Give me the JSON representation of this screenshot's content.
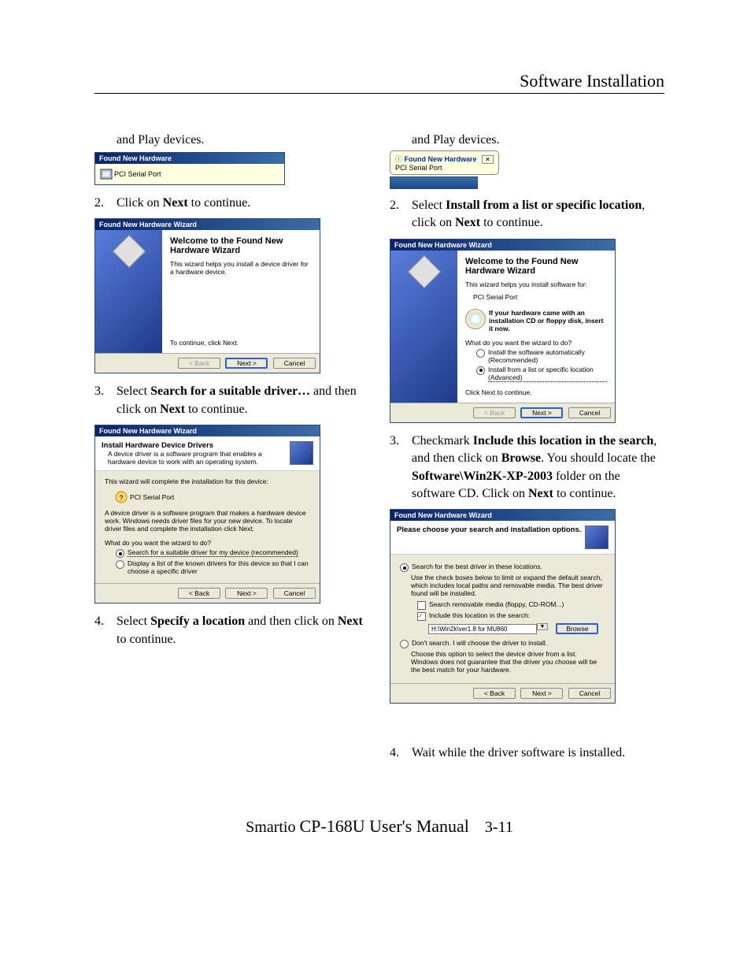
{
  "header": "Software Installation",
  "footer": {
    "prefix": "Smartio ",
    "manual": "CP-168U User's Manual",
    "page": "3-11"
  },
  "left": {
    "pnp": "and Play devices.",
    "s1": {
      "titlebar": "Found New Hardware",
      "device": "PCI Serial Port"
    },
    "step2": {
      "n": "2.",
      "a": "Click on ",
      "b": "Next",
      "c": " to continue."
    },
    "s2": {
      "titlebar": "Found New Hardware Wizard",
      "wtitle": "Welcome to the Found New Hardware Wizard",
      "sub": "This wizard helps you install a device driver for a hardware device.",
      "cont": "To continue, click Next.",
      "back": "< Back",
      "next": "Next >",
      "cancel": "Cancel"
    },
    "step3": {
      "n": "3.",
      "a": "Select ",
      "b": "Search for a suitable driver…",
      "c": " and then click on ",
      "d": "Next",
      "e": " to continue."
    },
    "s3": {
      "titlebar": "Found New Hardware Wizard",
      "htitle": "Install Hardware Device Drivers",
      "hsub": "A device driver is a software program that enables a hardware device to work with an operating system.",
      "line1": "This wizard will complete the installation for this device:",
      "device": "PCI Serial Port",
      "line2": "A device driver is a software program that makes a hardware device work. Windows needs driver files for your new device. To locate driver files and complete the installation click Next.",
      "q": "What do you want the wizard to do?",
      "r1": "Search for a suitable driver for my device (recommended)",
      "r2": "Display a list of the known drivers for this device so that I can choose a specific driver",
      "back": "< Back",
      "next": "Next >",
      "cancel": "Cancel"
    },
    "step4": {
      "n": "4.",
      "a": "Select ",
      "b": "Specify a location",
      "c": " and then click on ",
      "d": "Next",
      "e": " to continue."
    }
  },
  "right": {
    "pnp": "and Play devices.",
    "s1": {
      "btitle": "Found New Hardware",
      "device": "PCI Serial Port"
    },
    "step2": {
      "n": "2.",
      "a": "Select ",
      "b": "Install from a list or specific location",
      "c": ", click on ",
      "d": "Next",
      "e": " to continue."
    },
    "s2": {
      "titlebar": "Found New Hardware Wizard",
      "wtitle": "Welcome to the Found New Hardware Wizard",
      "sub": "This wizard helps you install software for:",
      "device": "PCI Serial Port",
      "cdnote": "If your hardware came with an installation CD or floppy disk, insert it now.",
      "q": "What do you want the wizard to do?",
      "r1": "Install the software automatically (Recommended)",
      "r2": "Install from a list or specific location (Advanced)",
      "cont": "Click Next to continue.",
      "back": "< Back",
      "next": "Next >",
      "cancel": "Cancel"
    },
    "step3": {
      "n": "3.",
      "a": "Checkmark ",
      "b": "Include this location in the search",
      "c": ", and then click on ",
      "d": "Browse",
      "e": ". You should locate the ",
      "f": "Software\\Win2K-XP-2003",
      "g": " folder on the software CD. Click on ",
      "h": "Next",
      "i": " to continue."
    },
    "s3": {
      "titlebar": "Found New Hardware Wizard",
      "htitle": "Please choose your search and installation options.",
      "r1": "Search for the best driver in these locations.",
      "r1sub": "Use the check boxes below to limit or expand the default search, which includes local paths and removable media. The best driver found will be installed.",
      "c1": "Search removable media (floppy, CD-ROM...)",
      "c2": "Include this location in the search:",
      "path": "H:\\Win2k\\ver1.8 for MU860",
      "browse": "Browse",
      "r2": "Don't search. I will choose the driver to install.",
      "r2sub": "Choose this option to select the device driver from a list. Windows does not guarantee that the driver you choose will be the best match for your hardware.",
      "back": "< Back",
      "next": "Next >",
      "cancel": "Cancel"
    },
    "step4": {
      "n": "4.",
      "a": "Wait while the driver software is installed."
    }
  }
}
